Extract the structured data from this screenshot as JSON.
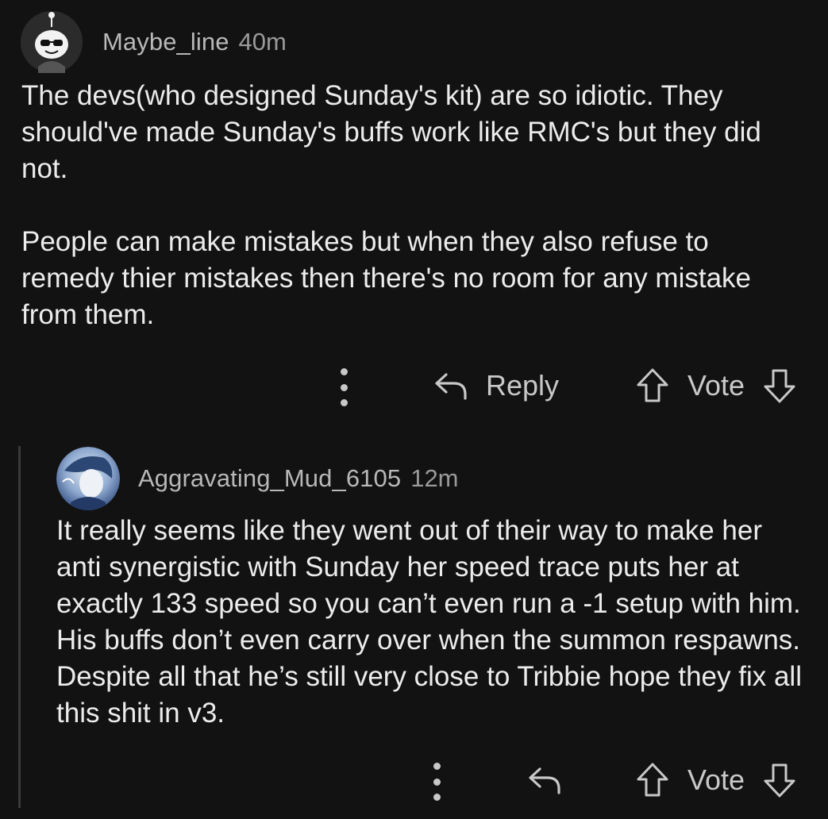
{
  "comments": [
    {
      "username": "Maybe_line",
      "time": "40m",
      "paragraphs": [
        "The devs(who designed Sunday's kit) are so idiotic. They should've made Sunday's buffs work like RMC's but they did not.",
        "People can make mistakes but when they also refuse to remedy thier mistakes then there's no room for any mistake from them."
      ],
      "actions": {
        "reply_label": "Reply",
        "vote_label": "Vote"
      }
    },
    {
      "username": "Aggravating_Mud_6105",
      "time": "12m",
      "paragraphs": [
        "It really seems like they went out of their way to make her anti synergistic with Sunday her speed trace puts her at exactly 133 speed so you can’t even run a -1 setup with him. His buffs don’t even carry over when the summon respawns. Despite all that he’s still very close to Tribbie hope they fix all this shit in v3."
      ],
      "actions": {
        "vote_label": "Vote"
      }
    }
  ],
  "icons": {
    "more": "more-vertical-icon",
    "reply": "reply-arrow-icon",
    "upvote": "upvote-arrow-icon",
    "downvote": "downvote-arrow-icon"
  },
  "colors": {
    "background": "#121212",
    "text": "#ececec",
    "meta": "#b8b8b8",
    "thread_line": "#3a3a3a"
  }
}
